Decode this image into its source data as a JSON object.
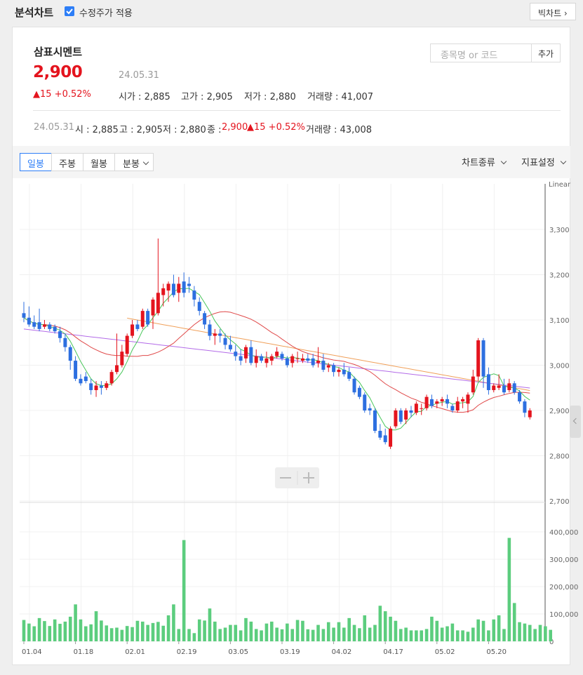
{
  "header": {
    "title": "분석차트",
    "adjusted_label": "수정주가 적용",
    "big_chart_btn": "빅차트 ›"
  },
  "stock": {
    "name": "삼표시멘트",
    "price": "2,900",
    "date": "24.05.31",
    "change": "▲15 +0.52%",
    "open_label": "시가 : 2,885",
    "high_label": "고가 : 2,905",
    "low_label": "저가 : 2,880",
    "volume_label": "거래량 : 41,007"
  },
  "search": {
    "placeholder": "종목명 or 코드",
    "add_label": "추가"
  },
  "detail": {
    "date": "24.05.31",
    "open": "시 : 2,885",
    "high": "고 : 2,905",
    "low": "저 : 2,880",
    "close_label": "종 :",
    "close": "2,900",
    "change": "▲15 +0.52%",
    "volume": "거래량 : 43,008"
  },
  "toolbar": {
    "daily": "일봉",
    "weekly": "주봉",
    "monthly": "월봉",
    "minute": "분봉",
    "chart_type": "차트종류",
    "indicator": "지표설정"
  },
  "colors": {
    "up": "#e4141e",
    "down": "#2d6fe0",
    "volume": "#5ccd7e",
    "ma5": "#48c65a",
    "ma20": "#e04a4a",
    "ma60": "#b36be8",
    "ma120": "#f0a05a",
    "accent": "#2d7ef7"
  },
  "chart_data": {
    "type": "candlestick",
    "scale_label": "Linear",
    "price_ticks": [
      3300,
      3200,
      3100,
      3000,
      2900,
      2800,
      2700
    ],
    "price_tick_labels": [
      "3,300",
      "3,200",
      "3,100",
      "3,000",
      "2,900",
      "2,800",
      "2,700"
    ],
    "volume_ticks": [
      400000,
      300000,
      200000,
      100000,
      0
    ],
    "volume_tick_labels": [
      "400,000",
      "300,000",
      "200,000",
      "100,000",
      "0"
    ],
    "x_labels": [
      {
        "index": 0,
        "label": "01.04"
      },
      {
        "index": 10,
        "label": "01.18"
      },
      {
        "index": 20,
        "label": "02.01"
      },
      {
        "index": 30,
        "label": "02.19"
      },
      {
        "index": 40,
        "label": "03.05"
      },
      {
        "index": 50,
        "label": "03.19"
      },
      {
        "index": 60,
        "label": "04.02"
      },
      {
        "index": 70,
        "label": "04.17"
      },
      {
        "index": 80,
        "label": "05.02"
      },
      {
        "index": 90,
        "label": "05.20"
      }
    ],
    "candles": [
      [
        3115,
        3140,
        3095,
        3105
      ],
      [
        3105,
        3130,
        3085,
        3090
      ],
      [
        3095,
        3110,
        3080,
        3085
      ],
      [
        3095,
        3125,
        3075,
        3080
      ],
      [
        3085,
        3100,
        3080,
        3090
      ],
      [
        3090,
        3095,
        3075,
        3080
      ],
      [
        3085,
        3090,
        3070,
        3075
      ],
      [
        3075,
        3085,
        3050,
        3060
      ],
      [
        3060,
        3070,
        3030,
        3040
      ],
      [
        3040,
        3045,
        2990,
        3010
      ],
      [
        3010,
        3020,
        2965,
        2970
      ],
      [
        2970,
        2980,
        2955,
        2960
      ],
      [
        2975,
        2985,
        2960,
        2965
      ],
      [
        2960,
        2970,
        2935,
        2945
      ],
      [
        2945,
        2965,
        2930,
        2955
      ],
      [
        2955,
        2965,
        2935,
        2950
      ],
      [
        2950,
        2965,
        2945,
        2960
      ],
      [
        2960,
        2990,
        2955,
        2985
      ],
      [
        2985,
        3070,
        2980,
        3000
      ],
      [
        3000,
        3045,
        2995,
        3030
      ],
      [
        3025,
        3070,
        3020,
        3065
      ],
      [
        3065,
        3100,
        3060,
        3090
      ],
      [
        3090,
        3100,
        3075,
        3080
      ],
      [
        3085,
        3125,
        3080,
        3120
      ],
      [
        3120,
        3125,
        3085,
        3090
      ],
      [
        3110,
        3150,
        3080,
        3145
      ],
      [
        3115,
        3280,
        3110,
        3160
      ],
      [
        3155,
        3180,
        3130,
        3170
      ],
      [
        3165,
        3185,
        3140,
        3180
      ],
      [
        3180,
        3200,
        3150,
        3155
      ],
      [
        3160,
        3195,
        3140,
        3180
      ],
      [
        3185,
        3205,
        3150,
        3160
      ],
      [
        3180,
        3195,
        3160,
        3175
      ],
      [
        3165,
        3175,
        3130,
        3145
      ],
      [
        3140,
        3150,
        3110,
        3120
      ],
      [
        3115,
        3120,
        3080,
        3090
      ],
      [
        3090,
        3100,
        3055,
        3065
      ],
      [
        3065,
        3080,
        3045,
        3070
      ],
      [
        3070,
        3080,
        3050,
        3065
      ],
      [
        3060,
        3070,
        3035,
        3045
      ],
      [
        3045,
        3065,
        3030,
        3035
      ],
      [
        3030,
        3045,
        3010,
        3020
      ],
      [
        3020,
        3035,
        3000,
        3010
      ],
      [
        3015,
        3045,
        3005,
        3040
      ],
      [
        3040,
        3055,
        3000,
        3005
      ],
      [
        3005,
        3035,
        2995,
        3020
      ],
      [
        3020,
        3025,
        3005,
        3010
      ],
      [
        3005,
        3030,
        2995,
        3015
      ],
      [
        3010,
        3025,
        3000,
        3020
      ],
      [
        3020,
        3040,
        3015,
        3030
      ],
      [
        3025,
        3030,
        3010,
        3015
      ],
      [
        3015,
        3020,
        2995,
        3000
      ],
      [
        3005,
        3025,
        2995,
        3020
      ],
      [
        3015,
        3030,
        3005,
        3015
      ],
      [
        3010,
        3025,
        3005,
        3015
      ],
      [
        3015,
        3025,
        3005,
        3010
      ],
      [
        3015,
        3025,
        2995,
        3000
      ],
      [
        3005,
        3040,
        2995,
        3010
      ],
      [
        3010,
        3025,
        2985,
        2990
      ],
      [
        2995,
        3005,
        2985,
        3000
      ],
      [
        3000,
        3005,
        2975,
        2985
      ],
      [
        2985,
        2995,
        2975,
        2990
      ],
      [
        2990,
        3005,
        2975,
        2980
      ],
      [
        2985,
        2995,
        2965,
        2970
      ],
      [
        2970,
        2975,
        2935,
        2940
      ],
      [
        2950,
        2955,
        2925,
        2930
      ],
      [
        2935,
        2940,
        2895,
        2900
      ],
      [
        2905,
        2915,
        2890,
        2900
      ],
      [
        2900,
        2905,
        2850,
        2855
      ],
      [
        2855,
        2870,
        2835,
        2840
      ],
      [
        2845,
        2860,
        2825,
        2830
      ],
      [
        2820,
        2865,
        2815,
        2860
      ],
      [
        2865,
        2905,
        2860,
        2900
      ],
      [
        2900,
        2905,
        2870,
        2875
      ],
      [
        2880,
        2905,
        2870,
        2900
      ],
      [
        2900,
        2910,
        2885,
        2895
      ],
      [
        2895,
        2920,
        2890,
        2915
      ],
      [
        2905,
        2915,
        2890,
        2905
      ],
      [
        2905,
        2935,
        2900,
        2930
      ],
      [
        2925,
        2935,
        2905,
        2910
      ],
      [
        2915,
        2925,
        2905,
        2920
      ],
      [
        2920,
        2930,
        2910,
        2925
      ],
      [
        2925,
        2935,
        2905,
        2915
      ],
      [
        2910,
        2915,
        2895,
        2900
      ],
      [
        2900,
        2930,
        2895,
        2920
      ],
      [
        2920,
        2930,
        2905,
        2925
      ],
      [
        2915,
        2940,
        2895,
        2935
      ],
      [
        2940,
        2990,
        2935,
        2975
      ],
      [
        2975,
        3060,
        2965,
        3055
      ],
      [
        3055,
        3060,
        2950,
        2975
      ],
      [
        2980,
        2995,
        2935,
        2945
      ],
      [
        2945,
        2960,
        2940,
        2955
      ],
      [
        2950,
        2980,
        2945,
        2955
      ],
      [
        2955,
        2970,
        2935,
        2940
      ],
      [
        2945,
        2970,
        2940,
        2960
      ],
      [
        2960,
        2965,
        2935,
        2940
      ],
      [
        2940,
        2945,
        2915,
        2920
      ],
      [
        2920,
        2925,
        2885,
        2895
      ],
      [
        2885,
        2905,
        2880,
        2900
      ]
    ],
    "volumes": [
      78000,
      65000,
      55000,
      85000,
      74000,
      56000,
      80000,
      64000,
      72000,
      90000,
      135000,
      80000,
      55000,
      62000,
      110000,
      76000,
      58000,
      48000,
      50000,
      42000,
      56000,
      52000,
      75000,
      72000,
      60000,
      67000,
      71000,
      57000,
      95000,
      135000,
      45000,
      370000,
      45000,
      30000,
      80000,
      76000,
      120000,
      72000,
      45000,
      50000,
      60000,
      60000,
      40000,
      85000,
      72000,
      45000,
      40000,
      65000,
      72000,
      50000,
      44000,
      65000,
      45000,
      78000,
      75000,
      44000,
      42000,
      60000,
      45000,
      70000,
      50000,
      70000,
      50000,
      85000,
      60000,
      48000,
      95000,
      50000,
      60000,
      130000,
      110000,
      90000,
      75000,
      45000,
      50000,
      40000,
      40000,
      40000,
      45000,
      90000,
      75000,
      50000,
      55000,
      65000,
      40000,
      40000,
      35000,
      50000,
      80000,
      75000,
      40000,
      80000,
      95000,
      45000,
      378000,
      140000,
      70000,
      65000,
      60000,
      45000,
      60000,
      55000,
      42000
    ]
  }
}
